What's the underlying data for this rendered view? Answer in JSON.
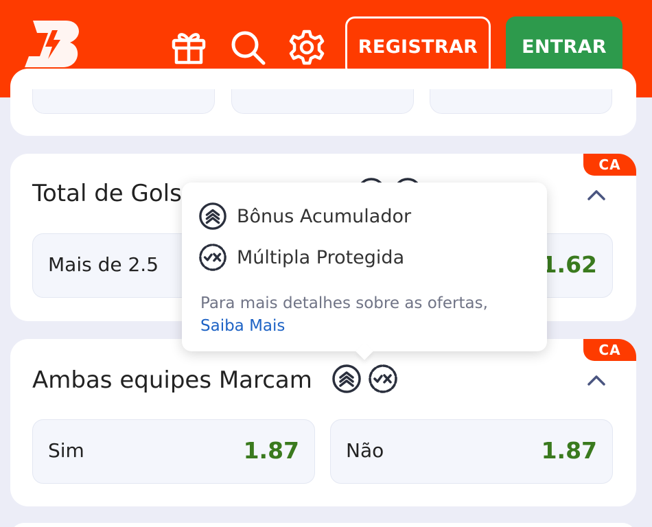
{
  "header": {
    "registrar_label": "REGISTRAR",
    "entrar_label": "ENTRAR",
    "colors": {
      "background": "#fe3b00",
      "entrar": "#2d9a4c"
    },
    "icons": [
      "logo",
      "gift-icon",
      "search-icon",
      "gear-icon"
    ]
  },
  "markets": [
    {
      "title": "Total de Gols",
      "badge": "CA",
      "options": [
        {
          "label": "Mais de 2.5",
          "odd": "1.62"
        }
      ]
    },
    {
      "title": "Ambas equipes Marcam",
      "badge": "CA",
      "options": [
        {
          "label": "Sim",
          "odd": "1.87"
        },
        {
          "label": "Não",
          "odd": "1.87"
        }
      ]
    }
  ],
  "tooltip": {
    "items": [
      {
        "icon": "bonus-accumulator-icon",
        "label": "Bônus Acumulador"
      },
      {
        "icon": "protected-multiple-icon",
        "label": "Múltipla Protegida"
      }
    ],
    "info_text": "Para mais detalhes sobre as ofertas,",
    "link_label": "Saiba Mais"
  },
  "colors": {
    "odds": "#3a7a1e",
    "link": "#1e63c5",
    "badge": "#fe3b00"
  }
}
